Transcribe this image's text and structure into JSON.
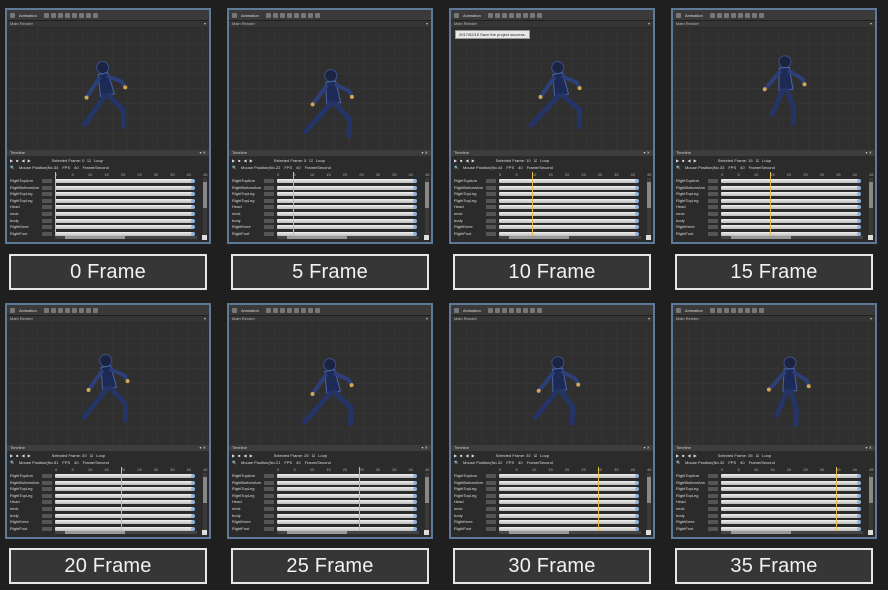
{
  "ui": {
    "toolbar_label": "Animation",
    "main_render": "Main Render",
    "toast": "2017/02/15 Save the project success.",
    "timeline_title": "Timeline",
    "loop_label": "Loop",
    "fps_label": "FPS",
    "fps_value": "40",
    "frames_per_second": "Frame/Second",
    "mouse_position_label": "Mouse Position(No.",
    "ruler_ticks": [
      "0",
      "5",
      "10",
      "15",
      "20",
      "25",
      "30",
      "35",
      "40",
      "45"
    ],
    "bones": [
      "RightTopArm",
      "RightBottomArm",
      "RightTopLeg",
      "RightTopLeg",
      "Head",
      "neck",
      "body",
      "RightKnee",
      "RightFoot"
    ]
  },
  "panels": [
    {
      "frame": 0,
      "caption": "0 Frame",
      "selected": "Selected Frame: 0",
      "mouse": "34",
      "toast": false
    },
    {
      "frame": 5,
      "caption": "5 Frame",
      "selected": "Selected Frame: 5",
      "mouse": "22",
      "toast": false
    },
    {
      "frame": 10,
      "caption": "10 Frame",
      "selected": "Selected Frame: 10",
      "mouse": "44",
      "toast": true
    },
    {
      "frame": 15,
      "caption": "15 Frame",
      "selected": "Selected Frame: 15",
      "mouse": "33",
      "toast": false
    },
    {
      "frame": 20,
      "caption": "20 Frame",
      "selected": "Selected Frame: 20",
      "mouse": "51",
      "toast": false
    },
    {
      "frame": 25,
      "caption": "25 Frame",
      "selected": "Selected Frame: 25",
      "mouse": "21",
      "toast": false
    },
    {
      "frame": 30,
      "caption": "30 Frame",
      "selected": "Selected Frame: 30",
      "mouse": "32",
      "toast": false
    },
    {
      "frame": 35,
      "caption": "35 Frame",
      "selected": "Selected Frame: 35",
      "mouse": "32",
      "toast": false
    }
  ],
  "colors": {
    "panel_border": "#5d7a99",
    "playhead": "#e5b94a",
    "caption_border": "#e6e6e6"
  }
}
